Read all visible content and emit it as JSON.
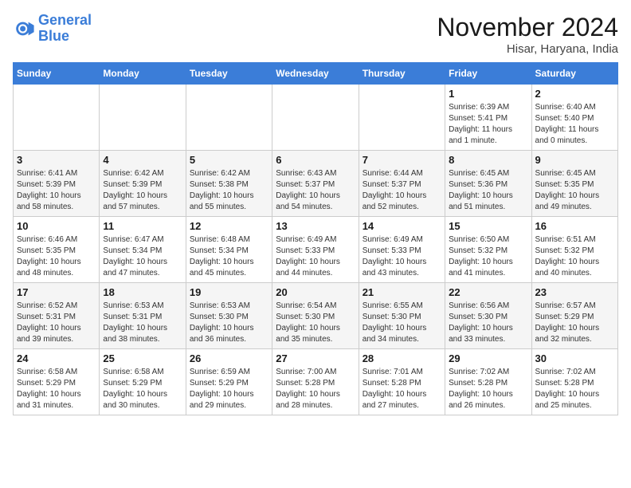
{
  "logo": {
    "line1": "General",
    "line2": "Blue"
  },
  "title": "November 2024",
  "location": "Hisar, Haryana, India",
  "days_header": [
    "Sunday",
    "Monday",
    "Tuesday",
    "Wednesday",
    "Thursday",
    "Friday",
    "Saturday"
  ],
  "weeks": [
    [
      {
        "day": "",
        "info": ""
      },
      {
        "day": "",
        "info": ""
      },
      {
        "day": "",
        "info": ""
      },
      {
        "day": "",
        "info": ""
      },
      {
        "day": "",
        "info": ""
      },
      {
        "day": "1",
        "info": "Sunrise: 6:39 AM\nSunset: 5:41 PM\nDaylight: 11 hours\nand 1 minute."
      },
      {
        "day": "2",
        "info": "Sunrise: 6:40 AM\nSunset: 5:40 PM\nDaylight: 11 hours\nand 0 minutes."
      }
    ],
    [
      {
        "day": "3",
        "info": "Sunrise: 6:41 AM\nSunset: 5:39 PM\nDaylight: 10 hours\nand 58 minutes."
      },
      {
        "day": "4",
        "info": "Sunrise: 6:42 AM\nSunset: 5:39 PM\nDaylight: 10 hours\nand 57 minutes."
      },
      {
        "day": "5",
        "info": "Sunrise: 6:42 AM\nSunset: 5:38 PM\nDaylight: 10 hours\nand 55 minutes."
      },
      {
        "day": "6",
        "info": "Sunrise: 6:43 AM\nSunset: 5:37 PM\nDaylight: 10 hours\nand 54 minutes."
      },
      {
        "day": "7",
        "info": "Sunrise: 6:44 AM\nSunset: 5:37 PM\nDaylight: 10 hours\nand 52 minutes."
      },
      {
        "day": "8",
        "info": "Sunrise: 6:45 AM\nSunset: 5:36 PM\nDaylight: 10 hours\nand 51 minutes."
      },
      {
        "day": "9",
        "info": "Sunrise: 6:45 AM\nSunset: 5:35 PM\nDaylight: 10 hours\nand 49 minutes."
      }
    ],
    [
      {
        "day": "10",
        "info": "Sunrise: 6:46 AM\nSunset: 5:35 PM\nDaylight: 10 hours\nand 48 minutes."
      },
      {
        "day": "11",
        "info": "Sunrise: 6:47 AM\nSunset: 5:34 PM\nDaylight: 10 hours\nand 47 minutes."
      },
      {
        "day": "12",
        "info": "Sunrise: 6:48 AM\nSunset: 5:34 PM\nDaylight: 10 hours\nand 45 minutes."
      },
      {
        "day": "13",
        "info": "Sunrise: 6:49 AM\nSunset: 5:33 PM\nDaylight: 10 hours\nand 44 minutes."
      },
      {
        "day": "14",
        "info": "Sunrise: 6:49 AM\nSunset: 5:33 PM\nDaylight: 10 hours\nand 43 minutes."
      },
      {
        "day": "15",
        "info": "Sunrise: 6:50 AM\nSunset: 5:32 PM\nDaylight: 10 hours\nand 41 minutes."
      },
      {
        "day": "16",
        "info": "Sunrise: 6:51 AM\nSunset: 5:32 PM\nDaylight: 10 hours\nand 40 minutes."
      }
    ],
    [
      {
        "day": "17",
        "info": "Sunrise: 6:52 AM\nSunset: 5:31 PM\nDaylight: 10 hours\nand 39 minutes."
      },
      {
        "day": "18",
        "info": "Sunrise: 6:53 AM\nSunset: 5:31 PM\nDaylight: 10 hours\nand 38 minutes."
      },
      {
        "day": "19",
        "info": "Sunrise: 6:53 AM\nSunset: 5:30 PM\nDaylight: 10 hours\nand 36 minutes."
      },
      {
        "day": "20",
        "info": "Sunrise: 6:54 AM\nSunset: 5:30 PM\nDaylight: 10 hours\nand 35 minutes."
      },
      {
        "day": "21",
        "info": "Sunrise: 6:55 AM\nSunset: 5:30 PM\nDaylight: 10 hours\nand 34 minutes."
      },
      {
        "day": "22",
        "info": "Sunrise: 6:56 AM\nSunset: 5:30 PM\nDaylight: 10 hours\nand 33 minutes."
      },
      {
        "day": "23",
        "info": "Sunrise: 6:57 AM\nSunset: 5:29 PM\nDaylight: 10 hours\nand 32 minutes."
      }
    ],
    [
      {
        "day": "24",
        "info": "Sunrise: 6:58 AM\nSunset: 5:29 PM\nDaylight: 10 hours\nand 31 minutes."
      },
      {
        "day": "25",
        "info": "Sunrise: 6:58 AM\nSunset: 5:29 PM\nDaylight: 10 hours\nand 30 minutes."
      },
      {
        "day": "26",
        "info": "Sunrise: 6:59 AM\nSunset: 5:29 PM\nDaylight: 10 hours\nand 29 minutes."
      },
      {
        "day": "27",
        "info": "Sunrise: 7:00 AM\nSunset: 5:28 PM\nDaylight: 10 hours\nand 28 minutes."
      },
      {
        "day": "28",
        "info": "Sunrise: 7:01 AM\nSunset: 5:28 PM\nDaylight: 10 hours\nand 27 minutes."
      },
      {
        "day": "29",
        "info": "Sunrise: 7:02 AM\nSunset: 5:28 PM\nDaylight: 10 hours\nand 26 minutes."
      },
      {
        "day": "30",
        "info": "Sunrise: 7:02 AM\nSunset: 5:28 PM\nDaylight: 10 hours\nand 25 minutes."
      }
    ]
  ]
}
